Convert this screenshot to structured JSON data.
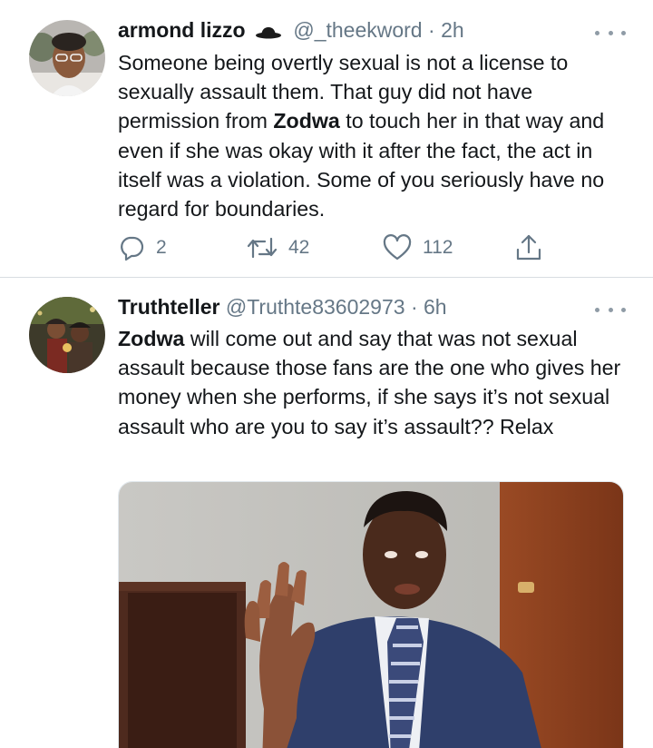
{
  "tweets": [
    {
      "display_name": "armond lizzo",
      "handle": "@_theekword",
      "separator": "·",
      "time": "2h",
      "text": {
        "part1": "Someone being overtly sexual is not a license to sexually assault them. That guy did not have permission  from ",
        "bold": "Zodwa",
        "part2": " to touch her in that way and even if she was okay with it after the fact, the act in itself was a violation. Some of you seriously have no regard for boundaries."
      },
      "actions": {
        "reply_count": "2",
        "retweet_count": "42",
        "like_count": "112"
      },
      "icons": [
        "reply-icon",
        "retweet-icon",
        "like-icon",
        "share-icon",
        "more-icon"
      ]
    },
    {
      "display_name": "Truthteller",
      "handle": "@Truthte83602973",
      "separator": "·",
      "time": "6h",
      "text": {
        "bold": "Zodwa",
        "part2": " will come out and say that was not sexual assault because those fans are the one who gives her money when she performs, if she says it’s not sexual assault who are you to say it’s assault?? Relax"
      },
      "media": "photo of a man in a suit with a raised hand",
      "icons": [
        "more-icon"
      ]
    }
  ],
  "colors": {
    "text_primary": "#14171a",
    "text_secondary": "#657786",
    "divider": "#d8dde1",
    "background": "#ffffff"
  }
}
